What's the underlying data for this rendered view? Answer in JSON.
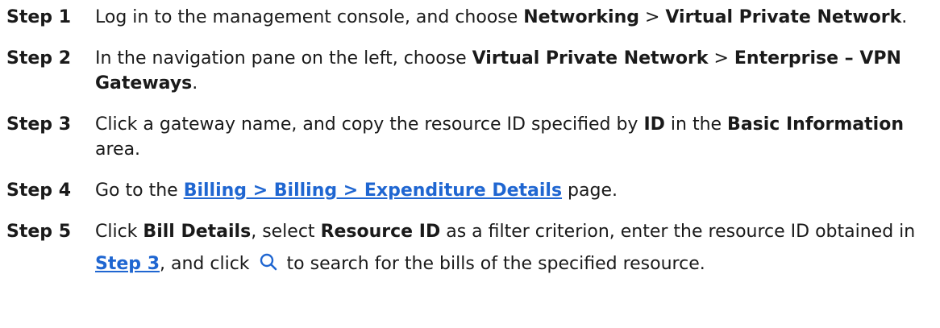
{
  "steps": [
    {
      "label": "Step 1",
      "t1": "Log in to the management console, and choose ",
      "b1": "Networking",
      "t2": " > ",
      "b2": "Virtual Private Network",
      "t3": "."
    },
    {
      "label": "Step 2",
      "t1": "In the navigation pane on the left, choose ",
      "b1": "Virtual Private Network",
      "t2": " > ",
      "b2": "Enterprise – VPN Gateways",
      "t3": "."
    },
    {
      "label": "Step 3",
      "t1": "Click a gateway name, and copy the resource ID specified by ",
      "b1": "ID",
      "t2": " in the ",
      "b2": "Basic Information",
      "t3": " area."
    },
    {
      "label": "Step 4",
      "t1": "Go to the ",
      "link": "Billing > Billing > Expenditure Details",
      "t2": " page."
    },
    {
      "label": "Step 5",
      "t1": "Click ",
      "b1": "Bill Details",
      "t2": ", select ",
      "b2": "Resource ID",
      "t3": " as a filter criterion, enter the resource ID obtained in ",
      "link": "Step 3",
      "t4": ", and click ",
      "icon": "search-icon",
      "t5": " to search for the bills of the specified resource."
    }
  ],
  "colors": {
    "link": "#1f66d1",
    "text": "#1a1a1a"
  }
}
